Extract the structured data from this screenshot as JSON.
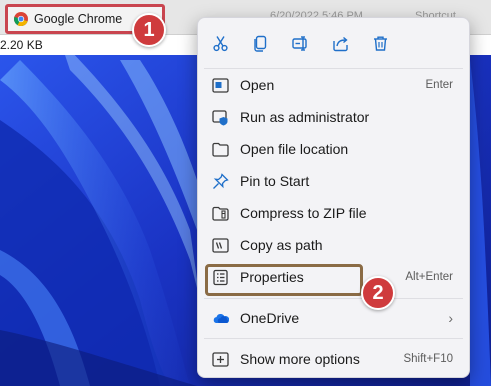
{
  "file_row": {
    "filename": "Google Chrome",
    "date": "6/20/2022 5:46 PM",
    "type": "Shortcut",
    "size": "2.20 KB"
  },
  "badges": {
    "step1": "1",
    "step2": "2"
  },
  "context_menu": {
    "quick_actions": [
      "cut-icon",
      "copy-icon",
      "rename-icon",
      "share-icon",
      "delete-icon"
    ],
    "items": [
      {
        "label": "Open",
        "shortcut": "Enter",
        "icon": "open-icon"
      },
      {
        "label": "Run as administrator",
        "shortcut": "",
        "icon": "shield-icon"
      },
      {
        "label": "Open file location",
        "shortcut": "",
        "icon": "folder-icon"
      },
      {
        "label": "Pin to Start",
        "shortcut": "",
        "icon": "pin-icon"
      },
      {
        "label": "Compress to ZIP file",
        "shortcut": "",
        "icon": "zip-icon"
      },
      {
        "label": "Copy as path",
        "shortcut": "",
        "icon": "copy-path-icon"
      },
      {
        "label": "Properties",
        "shortcut": "Alt+Enter",
        "icon": "properties-icon"
      },
      {
        "label": "OneDrive",
        "shortcut": "",
        "icon": "onedrive-icon"
      },
      {
        "label": "Show more options",
        "shortcut": "Shift+F10",
        "icon": "more-options-icon"
      }
    ]
  },
  "colors": {
    "highlight_red": "#c9454f",
    "badge_red": "#cf3b3d",
    "properties_outline": "#8a6b45",
    "wallpaper_blue": "#1b39c9"
  }
}
